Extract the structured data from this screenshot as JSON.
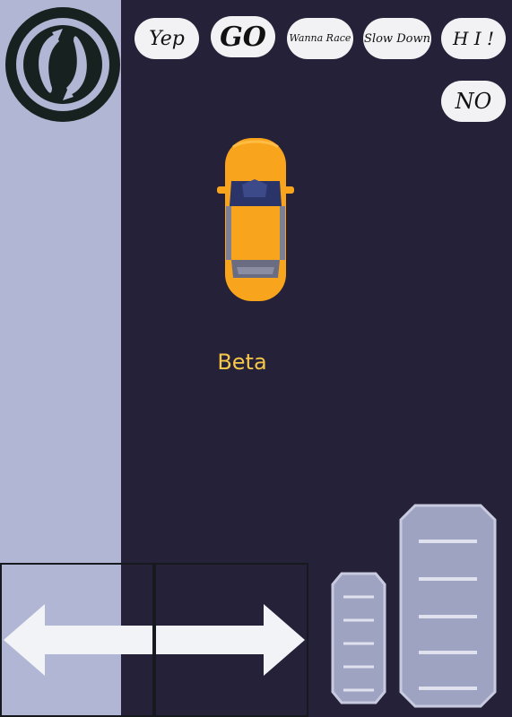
{
  "hud": {
    "reset_icon": "reset-rotate-icon",
    "quick_chat": [
      {
        "label": "Yep",
        "size": 22
      },
      {
        "label": "GO",
        "size": 30
      },
      {
        "label": "Wanna Race",
        "size": 11
      },
      {
        "label": "Slow Down",
        "size": 13
      },
      {
        "label": "H I !",
        "size": 20
      },
      {
        "label": "NO",
        "size": 24
      }
    ]
  },
  "player": {
    "name": "Beta",
    "car_color": "#f8a51d"
  },
  "controls": {
    "steer_left_icon": "arrow-left-icon",
    "steer_right_icon": "arrow-right-icon",
    "brake_icon": "brake-pedal-icon",
    "gas_icon": "gas-pedal-icon"
  },
  "colors": {
    "background": "#252138",
    "sidebar": "#b0b6d3",
    "accent_text": "#f4c64a",
    "pedal": "#9fa3c2"
  }
}
